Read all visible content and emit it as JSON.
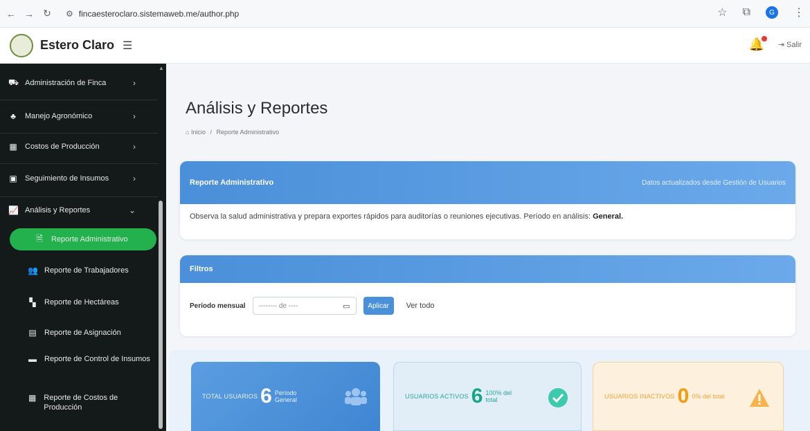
{
  "browser": {
    "url": "fincaesteroclaro.sistemaweb.me/author.php",
    "profile_initial": "G"
  },
  "header": {
    "logo_text": "ESTERO CLARO",
    "brand": "Estero Claro",
    "logout": "Salir"
  },
  "sidebar": {
    "items": [
      {
        "label": "Administración de Finca"
      },
      {
        "label": "Manejo Agronómico"
      },
      {
        "label": "Costos de Producción"
      },
      {
        "label": "Seguimiento de Insumos"
      },
      {
        "label": "Análisis y Reportes"
      }
    ],
    "subitems": [
      {
        "label": "Reporte Administrativo"
      },
      {
        "label": "Reporte de Trabajadores"
      },
      {
        "label": "Reporte de Hectáreas"
      },
      {
        "label": "Reporte de Asignación"
      },
      {
        "label": "Reporte de Control de Insumos"
      },
      {
        "label": "Reporte de Costos de Producción"
      }
    ]
  },
  "main": {
    "title": "Análisis y Reportes",
    "breadcrumb": {
      "home": "Inicio",
      "current": "Reporte Administrativo"
    },
    "report_card": {
      "title": "Reporte Administrativo",
      "right_note": "Datos actualizados desde Gestión de Usuarios",
      "description": "Observa la salud administrativa y prepara exportes rápidos para auditorías o reuniones ejecutivas. Período en análisis:",
      "period": "General."
    },
    "filters_card": {
      "title": "Filtros",
      "label": "Período mensual",
      "input_placeholder": "-------- de ----",
      "apply": "Aplicar",
      "see_all": "Ver todo"
    },
    "stats": [
      {
        "label": "Total usuarios",
        "value": "6",
        "sub": "Período General"
      },
      {
        "label": "Usuarios activos",
        "value": "6",
        "sub": "100% del total"
      },
      {
        "label": "Usuarios inactivos",
        "value": "0",
        "sub": "0% del total"
      }
    ]
  },
  "colors": {
    "accent": "#22b14c",
    "header_blue": "#4a8fd9",
    "sidebar_bg": "#141a1a"
  }
}
